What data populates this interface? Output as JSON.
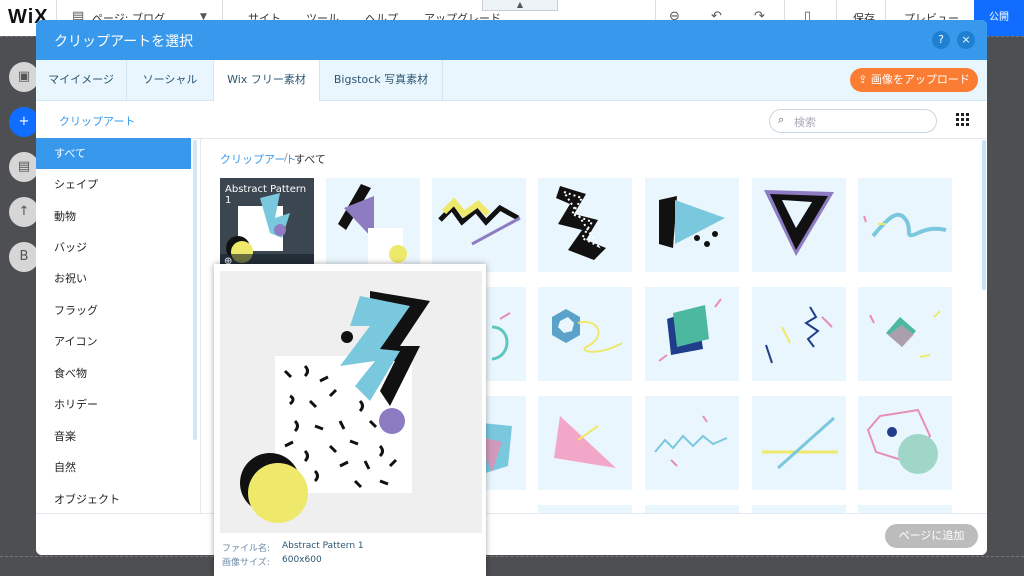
{
  "editor": {
    "logo": "WiX",
    "page_selector": "ページ: ブログ",
    "menu": [
      "サイト",
      "ツール",
      "ヘルプ",
      "アップグレード"
    ],
    "save_label": "保存",
    "preview_label": "プレビュー",
    "publish_label": "公開"
  },
  "dialog": {
    "title": "クリップアートを選択",
    "help_label": "?",
    "close_label": "×",
    "tabs": [
      {
        "label": "マイイメージ",
        "active": false
      },
      {
        "label": "ソーシャル",
        "active": false
      },
      {
        "label": "Wix フリー素材",
        "active": true
      },
      {
        "label": "Bigstock 写真素材",
        "active": false
      }
    ],
    "upload_label": "画像をアップロード",
    "section_link": "クリップアート",
    "search_placeholder": "検索",
    "categories": [
      {
        "label": "すべて",
        "active": true
      },
      {
        "label": "シェイプ"
      },
      {
        "label": "動物"
      },
      {
        "label": "バッジ"
      },
      {
        "label": "お祝い"
      },
      {
        "label": "フラッグ"
      },
      {
        "label": "アイコン"
      },
      {
        "label": "食べ物"
      },
      {
        "label": "ホリデー"
      },
      {
        "label": "音楽"
      },
      {
        "label": "自然"
      },
      {
        "label": "オブジェクト"
      }
    ],
    "breadcrumb": {
      "parent": "クリップアート",
      "separator": "/",
      "current": "すべて"
    },
    "hovered_tile_label": "Abstract Pattern 1",
    "add_button_label": "ページに追加",
    "preview": {
      "file_name_label": "ファイル名:",
      "file_name": "Abstract Pattern 1",
      "size_label": "画像サイズ:",
      "size": "600x600"
    }
  },
  "colors": {
    "accent": "#3899ec",
    "upload": "#fb7d33",
    "tile_bg": "#eaf6fd",
    "publish": "#116dff"
  }
}
